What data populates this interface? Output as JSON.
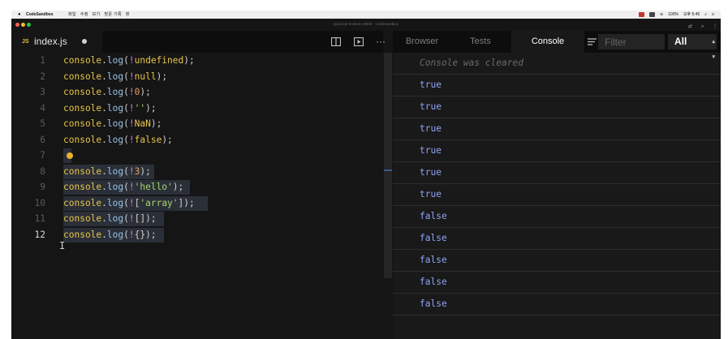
{
  "mac_menubar": {
    "app_name": "CodeSandbox",
    "menu_items": [
      "파일",
      "수정",
      "보기",
      "방문 기록",
      "창"
    ],
    "clock": "오후 5:45",
    "battery": "100%"
  },
  "window": {
    "title": "quizzical-mclaren-38bf4 - CodeSandbox"
  },
  "editor": {
    "file_tab": {
      "language_badge": "JS",
      "filename": "index.js",
      "unsaved_dot": true
    },
    "active_line": 12,
    "selection_lines": [
      7,
      8,
      9,
      10,
      11,
      12
    ],
    "lines": [
      {
        "n": "1",
        "tokens": [
          [
            "console",
            "obj"
          ],
          [
            ".",
            "pun"
          ],
          [
            "log",
            "fn"
          ],
          [
            "(",
            "pun"
          ],
          [
            "!",
            "op"
          ],
          [
            "undefined",
            "kw"
          ],
          [
            ");",
            "pun"
          ]
        ]
      },
      {
        "n": "2",
        "tokens": [
          [
            "console",
            "obj"
          ],
          [
            ".",
            "pun"
          ],
          [
            "log",
            "fn"
          ],
          [
            "(",
            "pun"
          ],
          [
            "!",
            "op"
          ],
          [
            "null",
            "kw"
          ],
          [
            ");",
            "pun"
          ]
        ]
      },
      {
        "n": "3",
        "tokens": [
          [
            "console",
            "obj"
          ],
          [
            ".",
            "pun"
          ],
          [
            "log",
            "fn"
          ],
          [
            "(",
            "pun"
          ],
          [
            "!",
            "op"
          ],
          [
            "0",
            "num"
          ],
          [
            ");",
            "pun"
          ]
        ]
      },
      {
        "n": "4",
        "tokens": [
          [
            "console",
            "obj"
          ],
          [
            ".",
            "pun"
          ],
          [
            "log",
            "fn"
          ],
          [
            "(",
            "pun"
          ],
          [
            "!",
            "op"
          ],
          [
            "''",
            "str"
          ],
          [
            ");",
            "pun"
          ]
        ]
      },
      {
        "n": "5",
        "tokens": [
          [
            "console",
            "obj"
          ],
          [
            ".",
            "pun"
          ],
          [
            "log",
            "fn"
          ],
          [
            "(",
            "pun"
          ],
          [
            "!",
            "op"
          ],
          [
            "NaN",
            "kw"
          ],
          [
            ");",
            "pun"
          ]
        ]
      },
      {
        "n": "6",
        "tokens": [
          [
            "console",
            "obj"
          ],
          [
            ".",
            "pun"
          ],
          [
            "log",
            "fn"
          ],
          [
            "(",
            "pun"
          ],
          [
            "!",
            "op"
          ],
          [
            "false",
            "kw"
          ],
          [
            ");",
            "pun"
          ]
        ]
      },
      {
        "n": "7",
        "tokens": []
      },
      {
        "n": "8",
        "tokens": [
          [
            "console",
            "obj"
          ],
          [
            ".",
            "pun"
          ],
          [
            "log",
            "fn"
          ],
          [
            "(",
            "pun"
          ],
          [
            "!",
            "op"
          ],
          [
            "3",
            "num"
          ],
          [
            ");",
            "pun"
          ]
        ]
      },
      {
        "n": "9",
        "tokens": [
          [
            "console",
            "obj"
          ],
          [
            ".",
            "pun"
          ],
          [
            "log",
            "fn"
          ],
          [
            "(",
            "pun"
          ],
          [
            "!",
            "op"
          ],
          [
            "'hello'",
            "str"
          ],
          [
            ");",
            "pun"
          ]
        ]
      },
      {
        "n": "10",
        "tokens": [
          [
            "console",
            "obj"
          ],
          [
            ".",
            "pun"
          ],
          [
            "log",
            "fn"
          ],
          [
            "(",
            "pun"
          ],
          [
            "!",
            "op"
          ],
          [
            "[",
            "pun"
          ],
          [
            "'array'",
            "str"
          ],
          [
            "]",
            "pun"
          ],
          [
            ");",
            "pun"
          ]
        ]
      },
      {
        "n": "11",
        "tokens": [
          [
            "console",
            "obj"
          ],
          [
            ".",
            "pun"
          ],
          [
            "log",
            "fn"
          ],
          [
            "(",
            "pun"
          ],
          [
            "!",
            "op"
          ],
          [
            "[]",
            "pun"
          ],
          [
            ");",
            "pun"
          ]
        ]
      },
      {
        "n": "12",
        "tokens": [
          [
            "console",
            "obj"
          ],
          [
            ".",
            "pun"
          ],
          [
            "log",
            "fn"
          ],
          [
            "(",
            "pun"
          ],
          [
            "!",
            "op"
          ],
          [
            "{}",
            "pun"
          ],
          [
            ");",
            "pun"
          ]
        ]
      }
    ]
  },
  "devtools": {
    "tabs": [
      "Browser",
      "Tests",
      "Console"
    ],
    "active_tab": "Console",
    "filter_placeholder": "Filter",
    "level": "All",
    "cleared_message": "Console was cleared",
    "output": [
      "true",
      "true",
      "true",
      "true",
      "true",
      "true",
      "false",
      "false",
      "false",
      "false",
      "false"
    ]
  },
  "colors": {
    "editor_bg": "#151515",
    "console_text": "#8ea4f5",
    "keyword": "#e8c547",
    "string": "#a8d46f"
  }
}
